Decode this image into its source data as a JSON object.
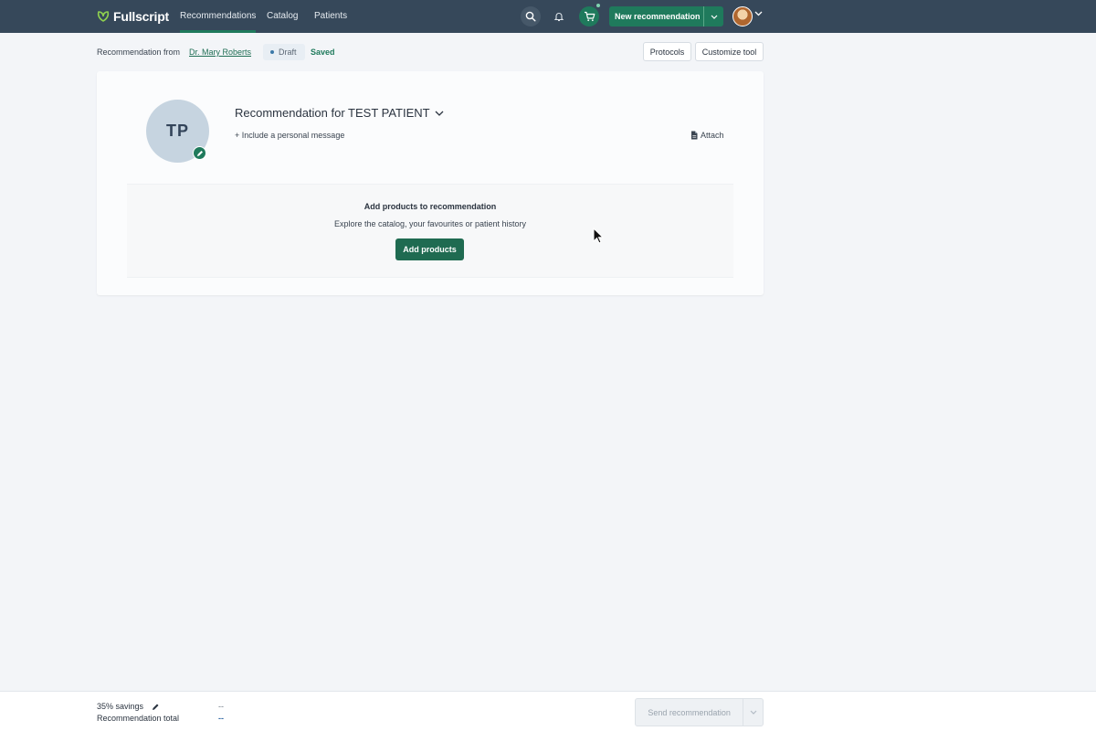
{
  "brand": {
    "name": "Fullscript",
    "accent": "#1f7a5c",
    "nav_bg": "#36485a"
  },
  "nav": {
    "links": [
      {
        "label": "Recommendations",
        "active": true
      },
      {
        "label": "Catalog",
        "active": false
      },
      {
        "label": "Patients",
        "active": false
      }
    ],
    "icons": [
      "search-icon",
      "bell-icon",
      "cart-icon"
    ],
    "new_recommendation_label": "New recommendation"
  },
  "subheader": {
    "label": "Recommendation from",
    "practitioner": "Dr. Mary Roberts",
    "status": "Draft",
    "save_state": "Saved",
    "protocols_label": "Protocols",
    "customize_label": "Customize tool"
  },
  "card": {
    "patient_initials": "TP",
    "title": "Recommendation for TEST PATIENT",
    "personal_message": "+ Include a personal message",
    "attach_label": "Attach",
    "products": {
      "title": "Add products to recommendation",
      "subtitle": "Explore the catalog, your favourites or patient history",
      "button": "Add products"
    }
  },
  "footer": {
    "savings_label": "35% savings",
    "savings_value": "--",
    "total_label": "Recommendation total",
    "total_value": "--",
    "send_label": "Send recommendation"
  }
}
